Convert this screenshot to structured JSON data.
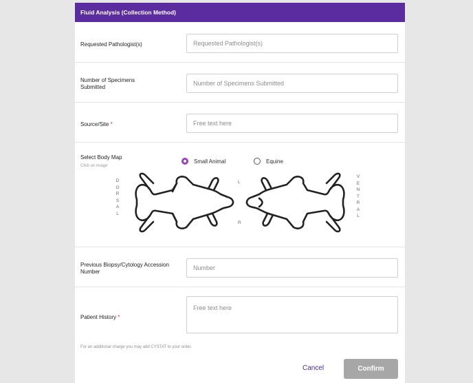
{
  "header": {
    "title": "Fluid Analysis (Collection Method)"
  },
  "fields": {
    "pathologist": {
      "label": "Requested Pathologist(s)",
      "placeholder": "Requested Pathologist(s)"
    },
    "specimens": {
      "label": "Number of Specimens Submitted",
      "placeholder": "Number of Specimens Submitted"
    },
    "source": {
      "label": "Source/Site",
      "required_mark": "*",
      "placeholder": "Free text here"
    },
    "biopsy": {
      "label": "Previous Biopsy/Cytology Accession Number",
      "placeholder": "Number"
    },
    "history": {
      "label": "Patient History",
      "required_mark": "*",
      "placeholder": "Free text here"
    }
  },
  "body_map": {
    "label": "Select Body Map",
    "hint": "Click on image",
    "options": [
      {
        "label": "Small Animal",
        "selected": true
      },
      {
        "label": "Equine",
        "selected": false
      }
    ],
    "left_word": "DORSAL",
    "right_word": "VENTRAL",
    "side_left": "L",
    "side_right": "R"
  },
  "note": "For an additional charge you may add CYSTAT to your order.",
  "actions": {
    "cancel_label": "Cancel",
    "confirm_label": "Confirm"
  },
  "colors": {
    "header_bg": "#5a2ca0",
    "radio_selected": "#9b3fbf",
    "cancel_text": "#4b2a9a",
    "confirm_bg": "#a7a7a7"
  }
}
